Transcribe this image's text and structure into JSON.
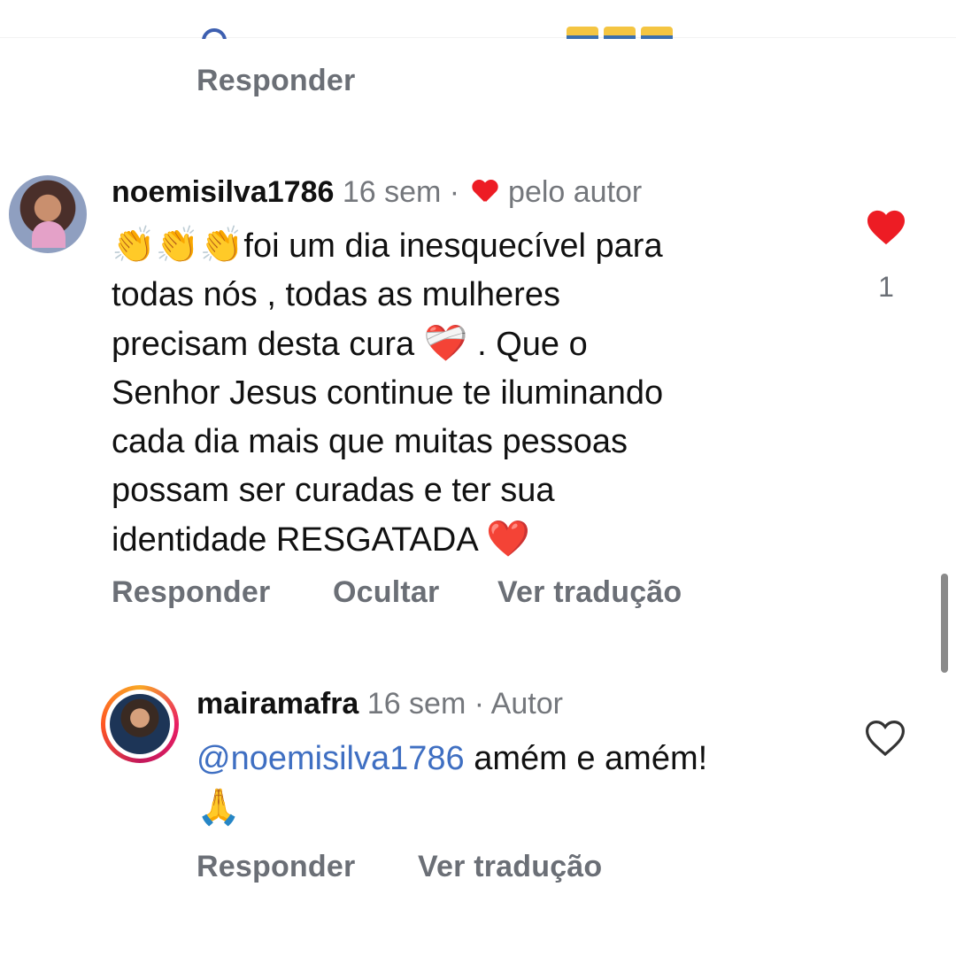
{
  "previous_comment": {
    "reply_label": "Responder"
  },
  "comment": {
    "username": "noemisilva1786",
    "time": "16 sem",
    "separator": "·",
    "liked_by_author_label": "pelo autor",
    "emoji_claps": "👏👏👏",
    "text_lines": [
      "foi um dia inesquecível para",
      "todas nós , todas as mulheres",
      "precisam desta cura",
      ". Que o",
      "Senhor Jesus continue te iluminando",
      "cada dia mais que muitas pessoas",
      "possam ser curadas e ter sua",
      "identidade  RESGATADA"
    ],
    "emoji_healing_heart": "❤️‍🩹",
    "emoji_heart": "❤️",
    "like_count": "1",
    "actions": {
      "reply": "Responder",
      "hide": "Ocultar",
      "translate": "Ver tradução"
    }
  },
  "reply": {
    "username": "mairamafra",
    "time": "16 sem",
    "separator": "·",
    "role": "Autor",
    "mention": "@noemisilva1786",
    "text": "amém e amém!",
    "emoji_pray": "🙏",
    "actions": {
      "reply": "Responder",
      "translate": "Ver tradução"
    }
  },
  "colors": {
    "like_red": "#ed1c24",
    "mention_blue": "#3f6fc2",
    "meta_gray": "#74777c",
    "action_gray": "#6b6f76"
  }
}
